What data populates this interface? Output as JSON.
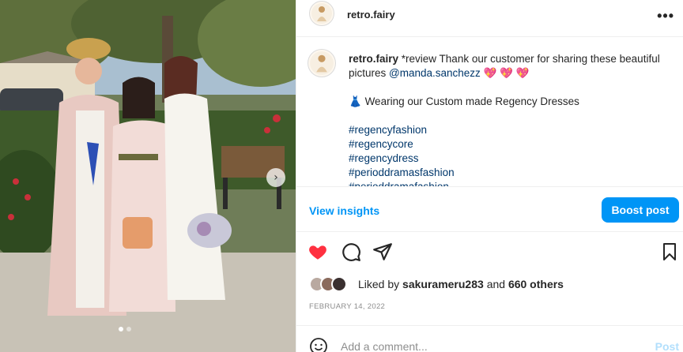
{
  "post": {
    "username": "retro.fairy",
    "more_label": "•••",
    "caption": {
      "username": "retro.fairy",
      "text_before": " *review Thank our customer for sharing these beautiful pictures ",
      "mention": "@manda.sanchezz",
      "hearts": " 💖 💖 💖",
      "dress_emoji": "👗",
      "dress_line": " Wearing our Custom made Regency Dresses",
      "hashtags": [
        "#regencyfashion",
        "#regencycore",
        "#regencydress",
        "#perioddramasfashion",
        "#perioddramafashion"
      ]
    },
    "insights": {
      "view_label": "View insights",
      "boost_label": "Boost post"
    },
    "likes": {
      "prefix": "Liked by ",
      "user": "sakurameru283",
      "middle": " and ",
      "others": "660 others"
    },
    "date": "FEBRUARY 14, 2022",
    "comment": {
      "placeholder": "Add a comment...",
      "post_label": "Post"
    },
    "icons": [
      "heart-icon",
      "comment-icon",
      "share-icon",
      "bookmark-icon",
      "emoji-icon",
      "chevron-right-icon"
    ],
    "colors": {
      "accent": "#0095f6",
      "heart": "#ff3040",
      "link": "#00376b"
    }
  }
}
